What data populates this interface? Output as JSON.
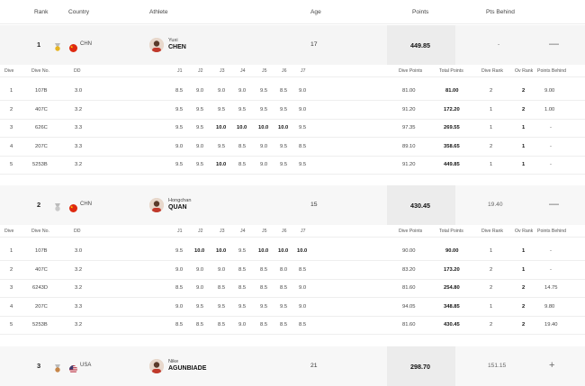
{
  "header": {
    "rank": "Rank",
    "country": "Country",
    "athlete": "Athlete",
    "age": "Age",
    "points": "Points",
    "pts_behind": "Pts Behind"
  },
  "dive_header": {
    "dive": "Dive",
    "dive_no": "Dive No.",
    "dd": "DD",
    "judges": [
      "J1",
      "J2",
      "J3",
      "J4",
      "J5",
      "J6",
      "J7"
    ],
    "dive_points": "Dive Points",
    "total_points": "Total Points",
    "dive_rank": "Dive Rank",
    "ov_rank": "Ov Rank",
    "points_behind": "Points Behind"
  },
  "athletes": [
    {
      "rank": "1",
      "medal": "gold",
      "medal_color": "#e6b422",
      "country": "CHN",
      "flag": "china-flag",
      "first_name": "Yuxi",
      "last_name": "CHEN",
      "age": "17",
      "points": "449.85",
      "pts_behind": "-",
      "toggle": "—",
      "dives": [
        {
          "dive": "1",
          "no": "107B",
          "dd": "3.0",
          "j": [
            "8.5",
            "9.0",
            "9.0",
            "9.0",
            "9.5",
            "8.5",
            "9.0"
          ],
          "jb": [],
          "dp": "81.00",
          "tp": "81.00",
          "dr": "2",
          "or": "2",
          "pb": "9.00"
        },
        {
          "dive": "2",
          "no": "407C",
          "dd": "3.2",
          "j": [
            "9.5",
            "9.5",
            "9.5",
            "9.5",
            "9.5",
            "9.5",
            "9.0"
          ],
          "jb": [],
          "dp": "91.20",
          "tp": "172.20",
          "dr": "1",
          "or": "2",
          "pb": "1.00"
        },
        {
          "dive": "3",
          "no": "626C",
          "dd": "3.3",
          "j": [
            "9.5",
            "9.5",
            "10.0",
            "10.0",
            "10.0",
            "10.0",
            "9.5"
          ],
          "jb": [
            2,
            3,
            4,
            5
          ],
          "dp": "97.35",
          "tp": "269.55",
          "dr": "1",
          "or": "1",
          "pb": "-"
        },
        {
          "dive": "4",
          "no": "207C",
          "dd": "3.3",
          "j": [
            "9.0",
            "9.0",
            "9.5",
            "8.5",
            "9.0",
            "9.5",
            "8.5"
          ],
          "jb": [],
          "dp": "89.10",
          "tp": "358.65",
          "dr": "2",
          "or": "1",
          "pb": "-"
        },
        {
          "dive": "5",
          "no": "5253B",
          "dd": "3.2",
          "j": [
            "9.5",
            "9.5",
            "10.0",
            "8.5",
            "9.0",
            "9.5",
            "9.5"
          ],
          "jb": [
            2
          ],
          "dp": "91.20",
          "tp": "449.85",
          "dr": "1",
          "or": "1",
          "pb": "-"
        }
      ]
    },
    {
      "rank": "2",
      "medal": "silver",
      "medal_color": "#c9c9c9",
      "country": "CHN",
      "flag": "china-flag",
      "first_name": "Hongchan",
      "last_name": "QUAN",
      "age": "15",
      "points": "430.45",
      "pts_behind": "19.40",
      "toggle": "—",
      "dives": [
        {
          "dive": "1",
          "no": "107B",
          "dd": "3.0",
          "j": [
            "9.5",
            "10.0",
            "10.0",
            "9.5",
            "10.0",
            "10.0",
            "10.0"
          ],
          "jb": [
            1,
            2,
            4,
            5,
            6
          ],
          "dp": "90.00",
          "tp": "90.00",
          "dr": "1",
          "or": "1",
          "pb": "-"
        },
        {
          "dive": "2",
          "no": "407C",
          "dd": "3.2",
          "j": [
            "9.0",
            "9.0",
            "9.0",
            "8.5",
            "8.5",
            "8.0",
            "8.5"
          ],
          "jb": [],
          "dp": "83.20",
          "tp": "173.20",
          "dr": "2",
          "or": "1",
          "pb": "-"
        },
        {
          "dive": "3",
          "no": "6243D",
          "dd": "3.2",
          "j": [
            "8.5",
            "9.0",
            "8.5",
            "8.5",
            "8.5",
            "8.5",
            "9.0"
          ],
          "jb": [],
          "dp": "81.60",
          "tp": "254.80",
          "dr": "2",
          "or": "2",
          "pb": "14.75"
        },
        {
          "dive": "4",
          "no": "207C",
          "dd": "3.3",
          "j": [
            "9.0",
            "9.5",
            "9.5",
            "9.5",
            "9.5",
            "9.5",
            "9.0"
          ],
          "jb": [],
          "dp": "94.05",
          "tp": "348.85",
          "dr": "1",
          "or": "2",
          "pb": "9.80"
        },
        {
          "dive": "5",
          "no": "5253B",
          "dd": "3.2",
          "j": [
            "8.5",
            "8.5",
            "8.5",
            "9.0",
            "8.5",
            "8.5",
            "8.5"
          ],
          "jb": [],
          "dp": "81.60",
          "tp": "430.45",
          "dr": "2",
          "or": "2",
          "pb": "19.40"
        }
      ]
    },
    {
      "rank": "3",
      "medal": "bronze",
      "medal_color": "#c7874a",
      "country": "USA",
      "flag": "usa-flag",
      "first_name": "Nike",
      "last_name": "AGUNBIADE",
      "age": "21",
      "points": "298.70",
      "pts_behind": "151.15",
      "toggle": "+",
      "dives": []
    }
  ]
}
